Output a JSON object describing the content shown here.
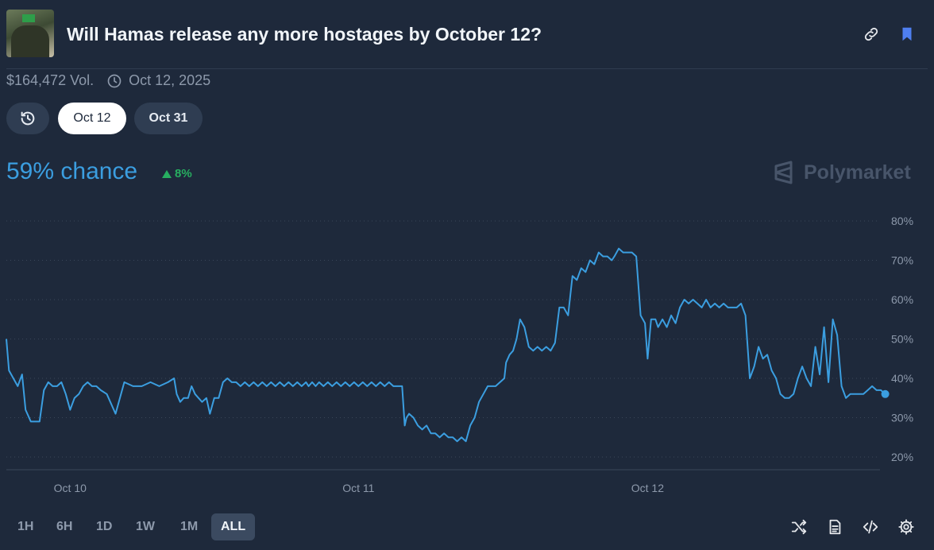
{
  "header": {
    "title": "Will Hamas release any more hostages by October 12?",
    "thumbnail_icon": "market-image",
    "link_icon": "link-icon",
    "bookmark_icon": "bookmark-icon"
  },
  "meta": {
    "volume": "$164,472 Vol.",
    "end_date": "Oct 12, 2025"
  },
  "date_tabs": [
    "Oct 12",
    "Oct 31"
  ],
  "selected_date_tab": "Oct 12",
  "stats": {
    "chance": "59% chance",
    "change": "8%",
    "change_direction": "up"
  },
  "brand": "Polymarket",
  "colors": {
    "line": "#3b9ee0",
    "up": "#27ae60",
    "background": "#1e293b"
  },
  "time_ranges": [
    "1H",
    "6H",
    "1D",
    "1W",
    "1M",
    "ALL"
  ],
  "selected_time_range": "ALL",
  "tools": [
    "shuffle-icon",
    "document-icon",
    "embed-code-icon",
    "settings-icon"
  ],
  "chart_data": {
    "type": "line",
    "x_ticks": [
      "Oct 10",
      "Oct 11",
      "Oct 12"
    ],
    "y_ticks": [
      "20%",
      "30%",
      "40%",
      "50%",
      "60%",
      "70%",
      "80%"
    ],
    "ylim": [
      20,
      80
    ],
    "xlim": [
      0,
      100
    ],
    "grid": true,
    "x": [
      0,
      0.3,
      0.8,
      1.3,
      1.8,
      2.2,
      2.8,
      3.3,
      3.8,
      4.3,
      4.8,
      5.3,
      5.8,
      6.3,
      6.8,
      7.3,
      7.8,
      8.3,
      8.8,
      9.3,
      9.8,
      10.3,
      10.8,
      11.5,
      12.5,
      13.5,
      14.5,
      15.5,
      16.5,
      17.5,
      18.5,
      19.2,
      19.5,
      19.9,
      20.3,
      20.8,
      21.2,
      21.6,
      22,
      22.4,
      22.9,
      23.3,
      23.8,
      24.3,
      24.8,
      25.3,
      25.8,
      26.3,
      26.8,
      27.3,
      27.8,
      28.3,
      28.8,
      29.3,
      29.8,
      30.3,
      30.8,
      31.3,
      31.8,
      32.3,
      32.8,
      33.3,
      33.8,
      34.3,
      34.6,
      35,
      35.4,
      35.8,
      36.3,
      36.8,
      37.3,
      37.8,
      38.3,
      38.8,
      39.3,
      39.8,
      40.3,
      40.8,
      41.3,
      41.8,
      42.3,
      42.8,
      43.3,
      43.8,
      44.3,
      45.3,
      45.6,
      45.8,
      46.1,
      46.6,
      47.1,
      47.6,
      48.1,
      48.6,
      49.1,
      49.6,
      50.1,
      50.6,
      51.1,
      51.6,
      52.1,
      52.6,
      53.1,
      53.6,
      54.1,
      54.6,
      55.1,
      56,
      57,
      57.2,
      57.6,
      58,
      58.4,
      58.8,
      59.3,
      59.8,
      60.3,
      60.8,
      61.3,
      61.8,
      62.3,
      62.8,
      63.3,
      63.8,
      64.3,
      64.8,
      65.3,
      65.8,
      66.3,
      66.8,
      67.3,
      67.8,
      68.3,
      68.8,
      69.3,
      69.6,
      70.1,
      70.6,
      71.1,
      71.6,
      72.1,
      72.6,
      73.1,
      73.4,
      73.8,
      74.3,
      74.6,
      75.1,
      75.6,
      76.1,
      76.6,
      77.1,
      77.6,
      78.1,
      78.6,
      79.1,
      79.6,
      80.1,
      80.6,
      81.1,
      81.6,
      82.1,
      82.6,
      83.1,
      83.6,
      84.1,
      84.6,
      85.1,
      85.6,
      86.1,
      86.6,
      87.1,
      87.6,
      88.1,
      88.6,
      89.1,
      89.6,
      90.1,
      90.6,
      91.1,
      91.6,
      92.1,
      92.6,
      93.1,
      93.6,
      94.1,
      94.6,
      95.1,
      95.6,
      96.1,
      96.6,
      97.1,
      97.6,
      98.1,
      98.6,
      99.1,
      99.6,
      100.1,
      100.6
    ],
    "y": [
      50,
      42,
      40,
      38,
      41,
      32,
      29,
      29,
      29,
      37,
      39,
      38,
      38,
      39,
      36,
      32,
      35,
      36,
      38,
      39,
      38,
      38,
      37,
      36,
      31,
      39,
      38,
      38,
      39,
      38,
      39,
      40,
      36,
      34,
      35,
      35,
      38,
      36,
      35,
      34,
      35,
      31,
      35,
      35,
      39,
      40,
      39,
      39,
      38,
      39,
      38,
      39,
      38,
      39,
      38,
      39,
      38,
      39,
      38,
      39,
      38,
      39,
      38,
      39,
      38,
      39,
      38,
      39,
      38,
      39,
      38,
      39,
      38,
      39,
      38,
      39,
      38,
      39,
      38,
      39,
      38,
      39,
      38,
      39,
      38,
      38,
      28,
      30,
      31,
      30,
      28,
      27,
      28,
      26,
      26,
      25,
      26,
      25,
      25,
      24,
      25,
      24,
      28,
      30,
      34,
      36,
      38,
      38,
      40,
      44,
      46,
      47,
      50,
      55,
      53,
      48,
      47,
      48,
      47,
      48,
      47,
      49,
      58,
      58,
      56,
      66,
      65,
      68,
      67,
      70,
      69,
      72,
      71,
      71,
      70,
      71,
      73,
      72,
      72,
      72,
      71,
      56,
      54,
      45,
      55,
      55,
      53,
      55,
      53,
      56,
      54,
      58,
      60,
      59,
      60,
      59,
      58,
      60,
      58,
      59,
      58,
      59,
      58,
      58,
      58,
      59,
      56,
      40,
      43,
      48,
      45,
      46,
      42,
      40,
      36,
      35,
      35,
      36,
      40,
      43,
      40,
      38,
      48,
      41,
      53,
      39,
      55,
      51,
      38,
      35,
      36,
      36,
      36,
      36,
      37,
      38,
      37,
      37,
      36,
      36
    ]
  }
}
